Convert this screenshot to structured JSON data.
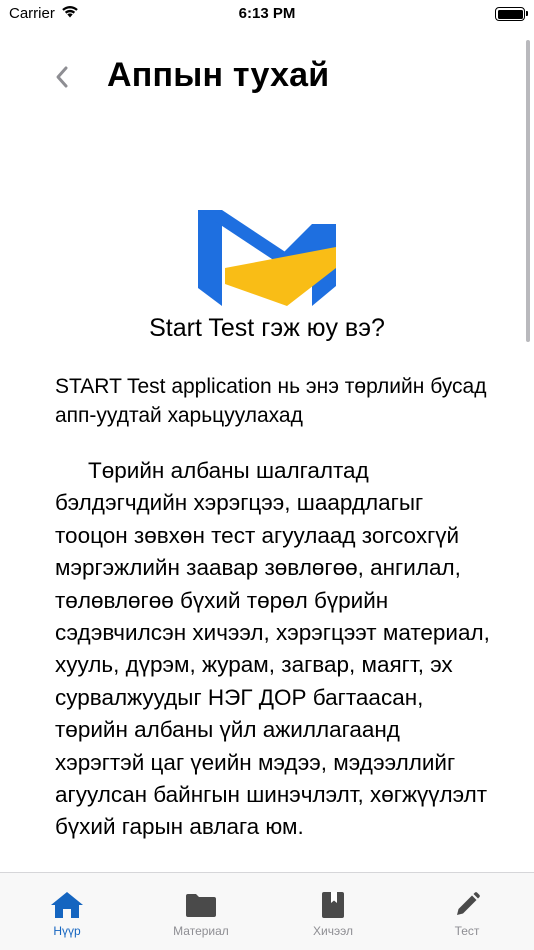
{
  "status_bar": {
    "carrier": "Carrier",
    "time": "6:13 PM"
  },
  "header": {
    "title": "Аппын тухай"
  },
  "content": {
    "question": "Start Test гэж юу вэ?",
    "intro": "START Test application нь энэ төрлийн бусад апп-уудтай харьцуулахад",
    "body": "Төрийн албаны шалгалтад бэлдэгчдийн хэрэгцээ, шаардлагыг тооцон зөвхөн тест агуулаад зогсохгүй мэргэжлийн заавар зөвлөгөө, ангилал, төлөвлөгөө бүхий төрөл бүрийн сэдэвчилсэн хичээл, хэрэгцээт материал, хууль, дүрэм, журам, загвар, маягт, эх сурвалжуудыг НЭГ ДОР багтаасан, төрийн албаны үйл ажиллагаанд хэрэгтэй цаг үеийн мэдээ, мэдээллийг агуулсан байнгын шинэчлэлт, хөгжүүлэлт бүхий гарын авлага юм."
  },
  "tab_bar": {
    "tabs": [
      {
        "label": "Нүүр",
        "icon": "home-icon",
        "active": true
      },
      {
        "label": "Материал",
        "icon": "folder-icon",
        "active": false
      },
      {
        "label": "Хичээл",
        "icon": "book-icon",
        "active": false
      },
      {
        "label": "Тест",
        "icon": "pencil-icon",
        "active": false
      }
    ]
  },
  "colors": {
    "accent": "#1565c0",
    "logo_blue": "#1e6fe0",
    "logo_yellow": "#f9bd16",
    "inactive_icon": "#4a4a4a"
  }
}
